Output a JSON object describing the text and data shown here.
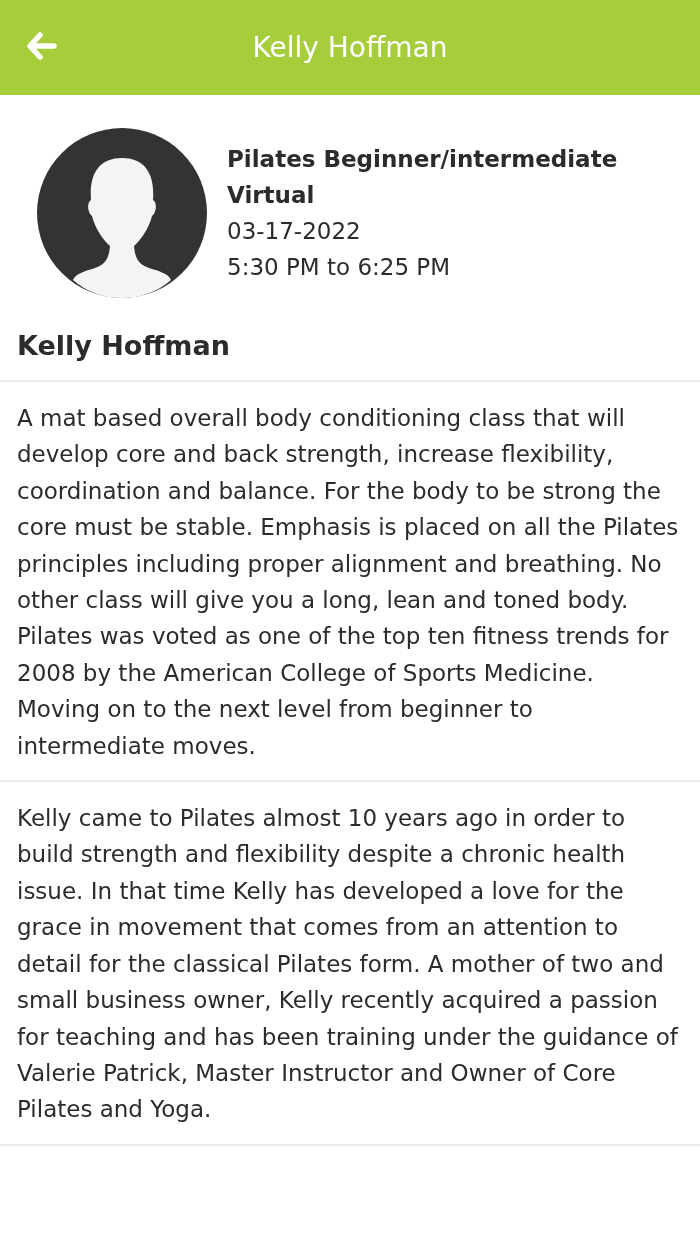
{
  "header": {
    "title": "Kelly Hoffman"
  },
  "class_info": {
    "name": "Pilates Beginner/intermediate Virtual",
    "date": "03-17-2022",
    "time": "5:30 PM to 6:25 PM"
  },
  "instructor": {
    "name": "Kelly Hoffman"
  },
  "sections": [
    {
      "text": "A mat based overall body conditioning class that will develop core and back strength, increase flexibility, coordination and balance. For the body to be strong the core must be stable. Emphasis is placed on all the Pilates principles including proper alignment and breathing. No other class will give you a long, lean and toned body. Pilates was voted as one of the top ten fitness trends for 2008 by the American College of Sports Medicine.\nMoving on to the next level from beginner to intermediate moves."
    },
    {
      "text": "Kelly came to Pilates almost 10 years ago in order to build strength and flexibility despite a chronic health issue. In that time Kelly has developed a love for the grace in movement that comes from an attention to detail for the classical Pilates form. A mother of two and small business owner, Kelly recently acquired a passion for teaching and has been training under the guidance of Valerie Patrick, Master Instructor and Owner of Core Pilates and Yoga."
    }
  ]
}
